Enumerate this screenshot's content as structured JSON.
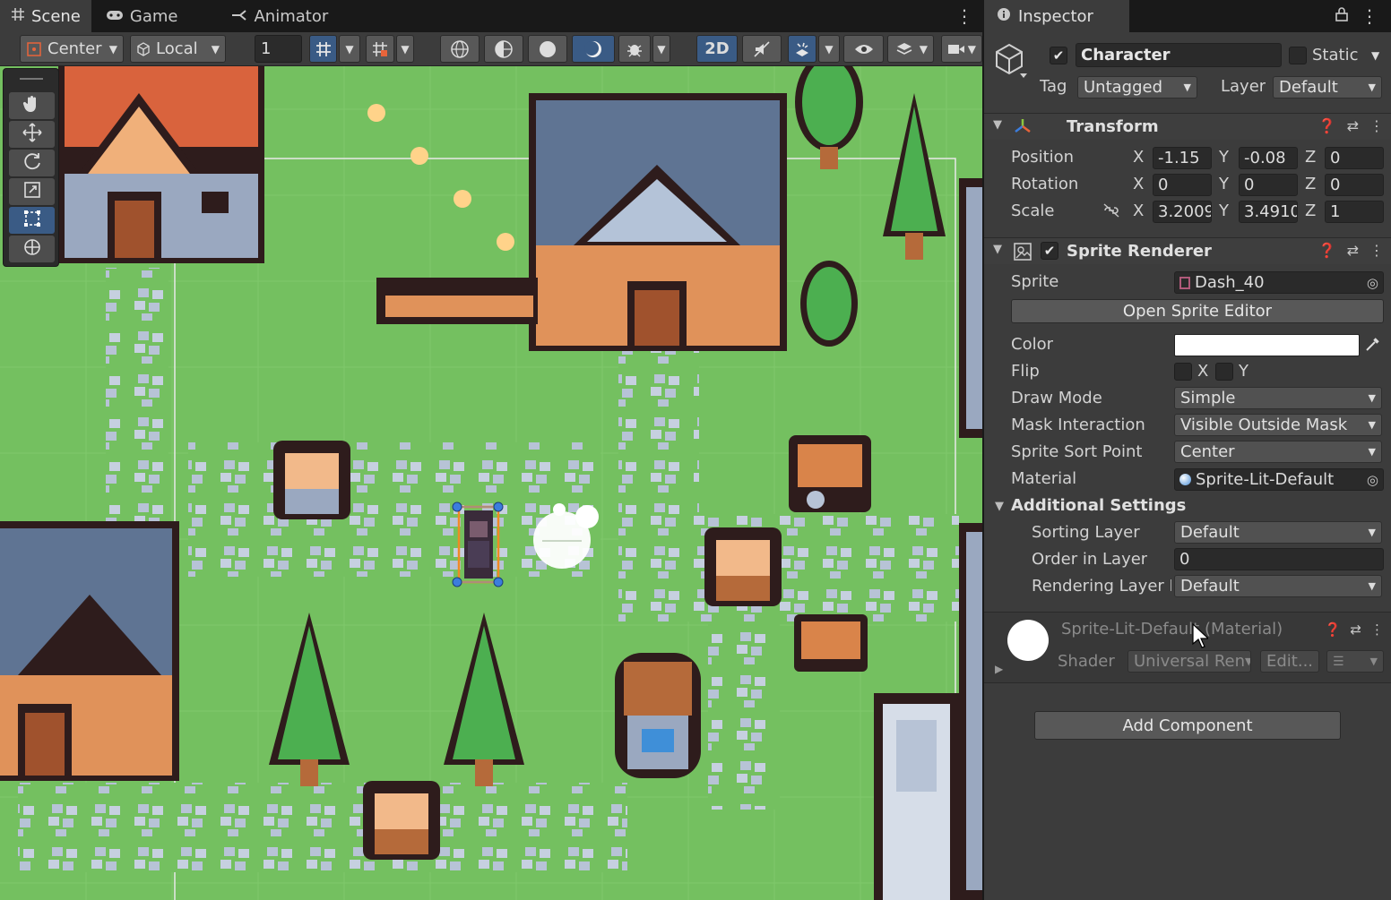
{
  "scene_tabs": [
    {
      "label": "Scene",
      "icon": "grid-icon"
    },
    {
      "label": "Game",
      "icon": "gamepad-icon"
    },
    {
      "label": "Animator",
      "icon": "animator-icon"
    }
  ],
  "scene_toolbar": {
    "pivot_mode": "Center",
    "pivot_rotation": "Local",
    "grid_snap_value": "1",
    "mode_2d_label": "2D"
  },
  "scene_tools": [
    "hand-tool",
    "move-tool",
    "rotate-tool",
    "scale-tool",
    "rect-tool",
    "transform-tool"
  ],
  "inspector": {
    "tab_label": "Inspector",
    "object": {
      "active": true,
      "name": "Character",
      "static_label": "Static",
      "tag_label": "Tag",
      "tag_value": "Untagged",
      "layer_label": "Layer",
      "layer_value": "Default"
    },
    "transform": {
      "title": "Transform",
      "position_label": "Position",
      "rotation_label": "Rotation",
      "scale_label": "Scale",
      "axis_x": "X",
      "axis_y": "Y",
      "axis_z": "Z",
      "position": {
        "x": "-1.15",
        "y": "-0.08",
        "z": "0"
      },
      "rotation": {
        "x": "0",
        "y": "0",
        "z": "0"
      },
      "scale": {
        "x": "3.2009",
        "y": "3.4910",
        "z": "1"
      }
    },
    "sprite_renderer": {
      "title": "Sprite Renderer",
      "enabled": true,
      "sprite_label": "Sprite",
      "sprite_value": "Dash_40",
      "open_editor_label": "Open Sprite Editor",
      "color_label": "Color",
      "color_value": "#ffffff",
      "flip_label": "Flip",
      "flip_x": "X",
      "flip_y": "Y",
      "draw_mode_label": "Draw Mode",
      "draw_mode_value": "Simple",
      "mask_label": "Mask Interaction",
      "mask_value": "Visible Outside Mask",
      "sort_point_label": "Sprite Sort Point",
      "sort_point_value": "Center",
      "material_label": "Material",
      "material_value": "Sprite-Lit-Default",
      "additional_label": "Additional Settings",
      "sorting_layer_label": "Sorting Layer",
      "sorting_layer_value": "Default",
      "order_label": "Order in Layer",
      "order_value": "0",
      "rendering_layer_label": "Rendering Layer M",
      "rendering_layer_value": "Default"
    },
    "material_section": {
      "title": "Sprite-Lit-Default (Material)",
      "shader_label": "Shader",
      "shader_value": "Universal Ren",
      "edit_label": "Edit..."
    },
    "add_component_label": "Add Component"
  },
  "colors": {
    "grass": "#74c060",
    "selection_blue": "#3a5b85",
    "panel": "#3c3c3c",
    "dark_bar": "#191919"
  }
}
